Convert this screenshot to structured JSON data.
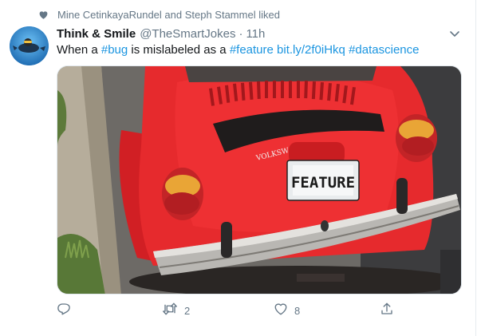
{
  "social_context": {
    "text": "Mine CetinkayaRundel and Steph Stammel liked"
  },
  "author": {
    "name": "Think & Smile",
    "handle": "@TheSmartJokes",
    "separator": "·",
    "time": "11h"
  },
  "tweet": {
    "t1": "When a ",
    "hashtag1": "#bug",
    "t2": " is mislabeled as a ",
    "hashtag2": "#feature",
    "t3": " ",
    "url": "bit.ly/2f0iHkq",
    "t4": " ",
    "hashtag3": "#datascience"
  },
  "photo": {
    "plate_text": "FEATURE",
    "badge_text": "VOLKSWAGEN"
  },
  "actions": {
    "reply_count": "",
    "retweet_count": "2",
    "like_count": "8"
  },
  "colors": {
    "link": "#1b95e0",
    "muted": "#657786",
    "car_red": "#e8282c"
  },
  "icons": [
    "heart-icon",
    "chevron-down-icon",
    "reply-icon",
    "retweet-icon",
    "like-icon",
    "share-icon"
  ]
}
